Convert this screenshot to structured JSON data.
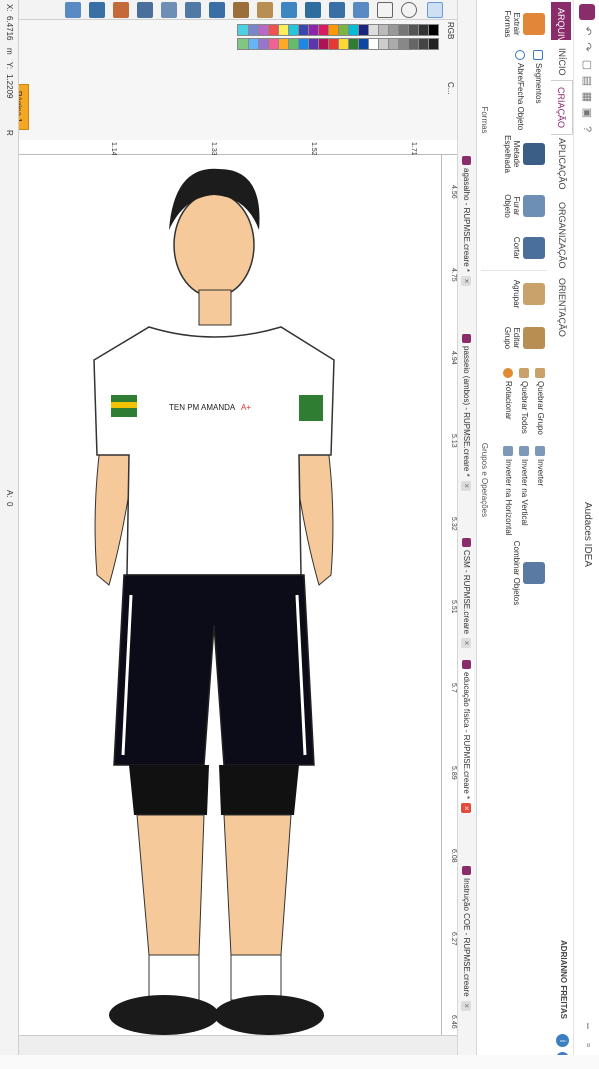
{
  "titlebar": {
    "title": "Audaces IDEA"
  },
  "tabs": {
    "file": "ARQUIVO",
    "items": [
      "INÍCIO",
      "CRIAÇÃO",
      "APLICAÇÃO",
      "ORGANIZAÇÃO",
      "ORIENTAÇÃO"
    ]
  },
  "user": "ADRIANNO FREITAS",
  "ribbon": {
    "formas": {
      "extrair": "Extrair Formas",
      "segmentos": "Segmentos",
      "abre_fecha": "Abre/Fecha Objeto",
      "metade": "Metade Espelhada",
      "furar": "Furar Objeto",
      "cortar": "Cortar",
      "label": "Formas"
    },
    "grupos": {
      "agrupar": "Agrupar",
      "editar": "Editar Grupo",
      "quebrar_grupo": "Quebrar Grupo",
      "quebrar_todos": "Quebrar Todos",
      "rotacionar": "Rotacionar",
      "inverter": "Inverter",
      "inverter_vertical": "Inverter na Vertical",
      "inverter_horizontal": "Inverter na Horizontal",
      "combinar": "Combinar Objetos",
      "label": "Grupos e Operações"
    }
  },
  "doc_tabs": [
    {
      "label": "agasalho - RUPMSE.creare *",
      "active": false
    },
    {
      "label": "passeio (ambos) - RUPMSE.creare *",
      "active": false
    },
    {
      "label": "CSM - RUPMSE.creare",
      "active": false
    },
    {
      "label": "educação física - RUPMSE.creare *",
      "active": true
    },
    {
      "label": "Instrução COE - RUPMSE.creare",
      "active": false
    }
  ],
  "ruler": {
    "ticks": [
      "4.56",
      "4.75",
      "4.94",
      "5.13",
      "5.32",
      "5.51",
      "5.7",
      "5.89",
      "6.08",
      "6.27",
      "6.46"
    ],
    "vticks": [
      "1.71",
      "1.52",
      "1.33",
      "1.14"
    ]
  },
  "shirt_label": {
    "name": "TEN PM AMANDA",
    "blood": "A+"
  },
  "palette": {
    "model_a": "RGB",
    "model_b": "C..."
  },
  "status": {
    "x_label": "X:",
    "x": "6.4716",
    "unit": "m",
    "y_label": "Y:",
    "y": "1.2209",
    "page": "Página 1",
    "r": "R",
    "a_label": "A:",
    "a": "0"
  }
}
